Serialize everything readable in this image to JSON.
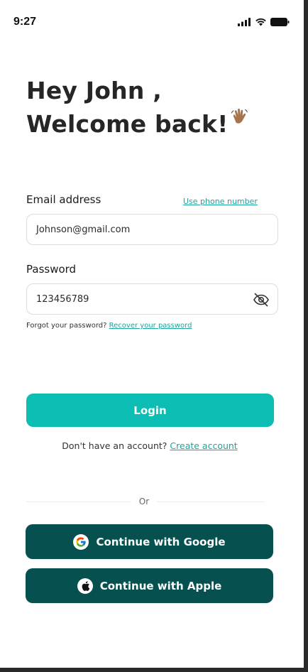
{
  "status_bar": {
    "time": "9:27",
    "icons": [
      "cellular-signal-icon",
      "wifi-icon",
      "battery-icon"
    ]
  },
  "header": {
    "greeting": "Hey John ,",
    "welcome": "Welcome back!",
    "emoji": "waving-hand-icon"
  },
  "email": {
    "label": "Email address",
    "alt_link": "Use phone number",
    "value": "Johnson@gmail.com"
  },
  "password": {
    "label": "Password",
    "value": "123456789",
    "toggle_icon": "eye-off-icon"
  },
  "forgot": {
    "text": "Forgot your password?",
    "link": "Recover your password"
  },
  "login": {
    "label": "Login"
  },
  "signup": {
    "text": "Don't have an account?",
    "link": "Create account"
  },
  "divider": {
    "text": "Or"
  },
  "social": {
    "google": {
      "label": "Continue with Google",
      "icon": "google-icon"
    },
    "apple": {
      "label": "Continue with Apple",
      "icon": "apple-icon"
    }
  },
  "colors": {
    "primary": "#0cbdb3",
    "dark_button": "#06514f",
    "link": "#1fa39a",
    "heading": "#262626"
  }
}
